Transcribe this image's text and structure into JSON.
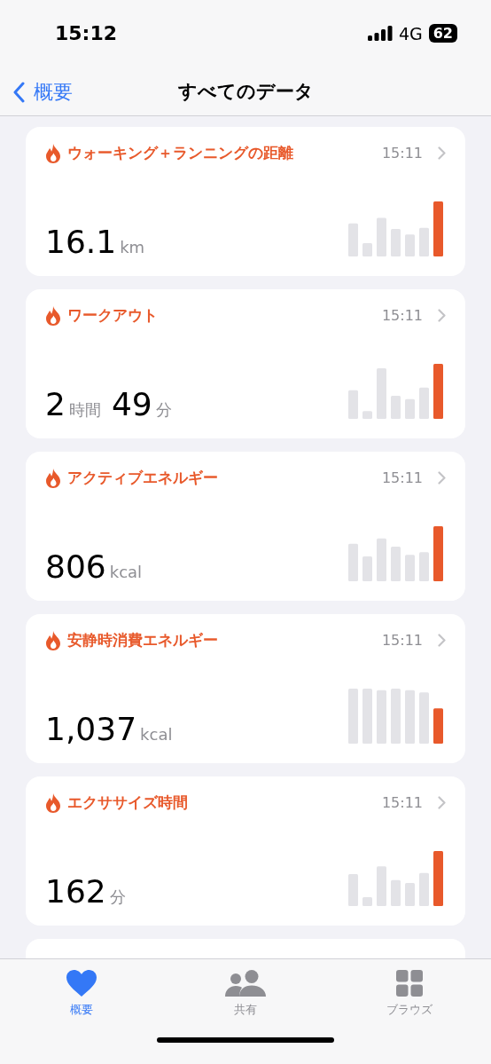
{
  "status_bar": {
    "time": "15:12",
    "network": "4G",
    "battery": "62"
  },
  "nav": {
    "back": "概要",
    "title": "すべてのデータ"
  },
  "cards": [
    {
      "title": "ウォーキング＋ランニングの距離",
      "time": "15:11",
      "value": [
        {
          "number": "16.1",
          "unit": "km"
        }
      ]
    },
    {
      "title": "ワークアウト",
      "time": "15:11",
      "value": [
        {
          "number": "2",
          "unit": "時間"
        },
        {
          "number": "49",
          "unit": "分"
        }
      ]
    },
    {
      "title": "アクティブエネルギー",
      "time": "15:11",
      "value": [
        {
          "number": "806",
          "unit": "kcal"
        }
      ]
    },
    {
      "title": "安静時消費エネルギー",
      "time": "15:11",
      "value": [
        {
          "number": "1,037",
          "unit": "kcal"
        }
      ]
    },
    {
      "title": "エクササイズ時間",
      "time": "15:11",
      "value": [
        {
          "number": "162",
          "unit": "分"
        }
      ]
    }
  ],
  "tabs": [
    {
      "label": "概要",
      "kind": "heart",
      "selected": true
    },
    {
      "label": "共有",
      "kind": "people",
      "selected": false
    },
    {
      "label": "ブラウズ",
      "kind": "grid",
      "selected": false
    }
  ]
}
